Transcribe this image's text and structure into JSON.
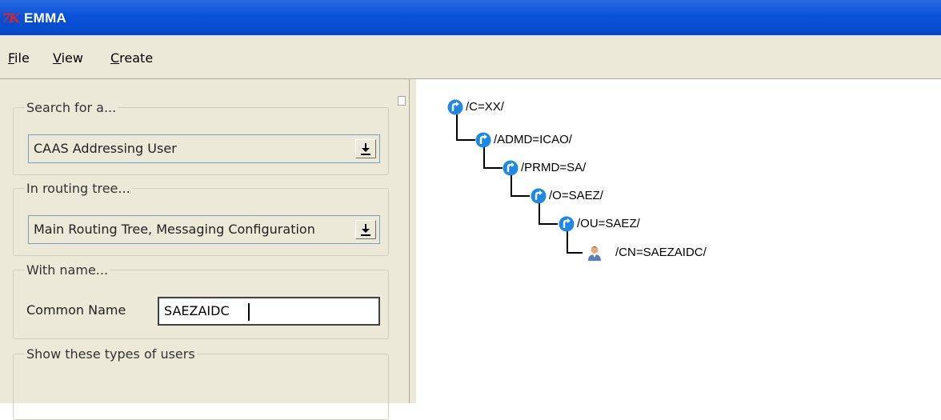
{
  "window": {
    "title": "EMMA",
    "logo_text": "7K"
  },
  "menu": {
    "file": {
      "mnemonic": "F",
      "rest": "ile"
    },
    "view": {
      "mnemonic": "V",
      "rest": "iew"
    },
    "create": {
      "mnemonic": "C",
      "rest": "reate"
    }
  },
  "search": {
    "search_for": {
      "legend": "Search for a...",
      "value": "CAAS Addressing User"
    },
    "routing_tree": {
      "legend": "In routing tree...",
      "value": "Main Routing Tree, Messaging Configuration"
    },
    "with_name": {
      "legend": "With name...",
      "label": "Common Name",
      "value": "SAEZAIDC"
    },
    "user_types": {
      "legend": "Show these types of users"
    }
  },
  "tree": {
    "nodes": [
      {
        "label": "/C=XX/",
        "icon": "routing-node-icon"
      },
      {
        "label": "/ADMD=ICAO/",
        "icon": "routing-node-icon"
      },
      {
        "label": "/PRMD=SA/",
        "icon": "routing-node-icon"
      },
      {
        "label": "/O=SAEZ/",
        "icon": "routing-node-icon"
      },
      {
        "label": "/OU=SAEZ/",
        "icon": "routing-node-icon"
      },
      {
        "label": "/CN=SAEZAIDC/",
        "icon": "user-icon"
      }
    ]
  },
  "colors": {
    "titlebar": "#0a52d8",
    "panel_bg": "#ece9d8",
    "node_icon": "#1e88e5"
  }
}
